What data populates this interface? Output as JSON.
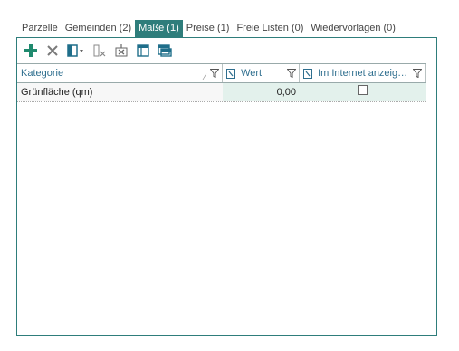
{
  "tabs": [
    {
      "label": "Parzelle"
    },
    {
      "label": "Gemeinden (2)"
    },
    {
      "label": "Maße (1)"
    },
    {
      "label": "Preise (1)"
    },
    {
      "label": "Freie Listen (0)"
    },
    {
      "label": "Wiedervorlagen (0)"
    }
  ],
  "active_tab": "Maße (1)",
  "toolbar": {
    "icons": [
      "add-icon",
      "delete-icon",
      "column-chooser-icon",
      "clear-filter-icon",
      "export-icon",
      "table-icon",
      "table-multi-icon"
    ]
  },
  "grid": {
    "columns": [
      {
        "label": "Kategorie"
      },
      {
        "label": "Wert"
      },
      {
        "label": "Im Internet anzeig…"
      }
    ],
    "rows": [
      {
        "kategorie": "Grünfläche (qm)",
        "wert": "0,00",
        "internet": false
      }
    ]
  },
  "colors": {
    "accent": "#2e7d7b",
    "highlight": "#e3f1ec",
    "icon_green": "#1f8a6e"
  }
}
